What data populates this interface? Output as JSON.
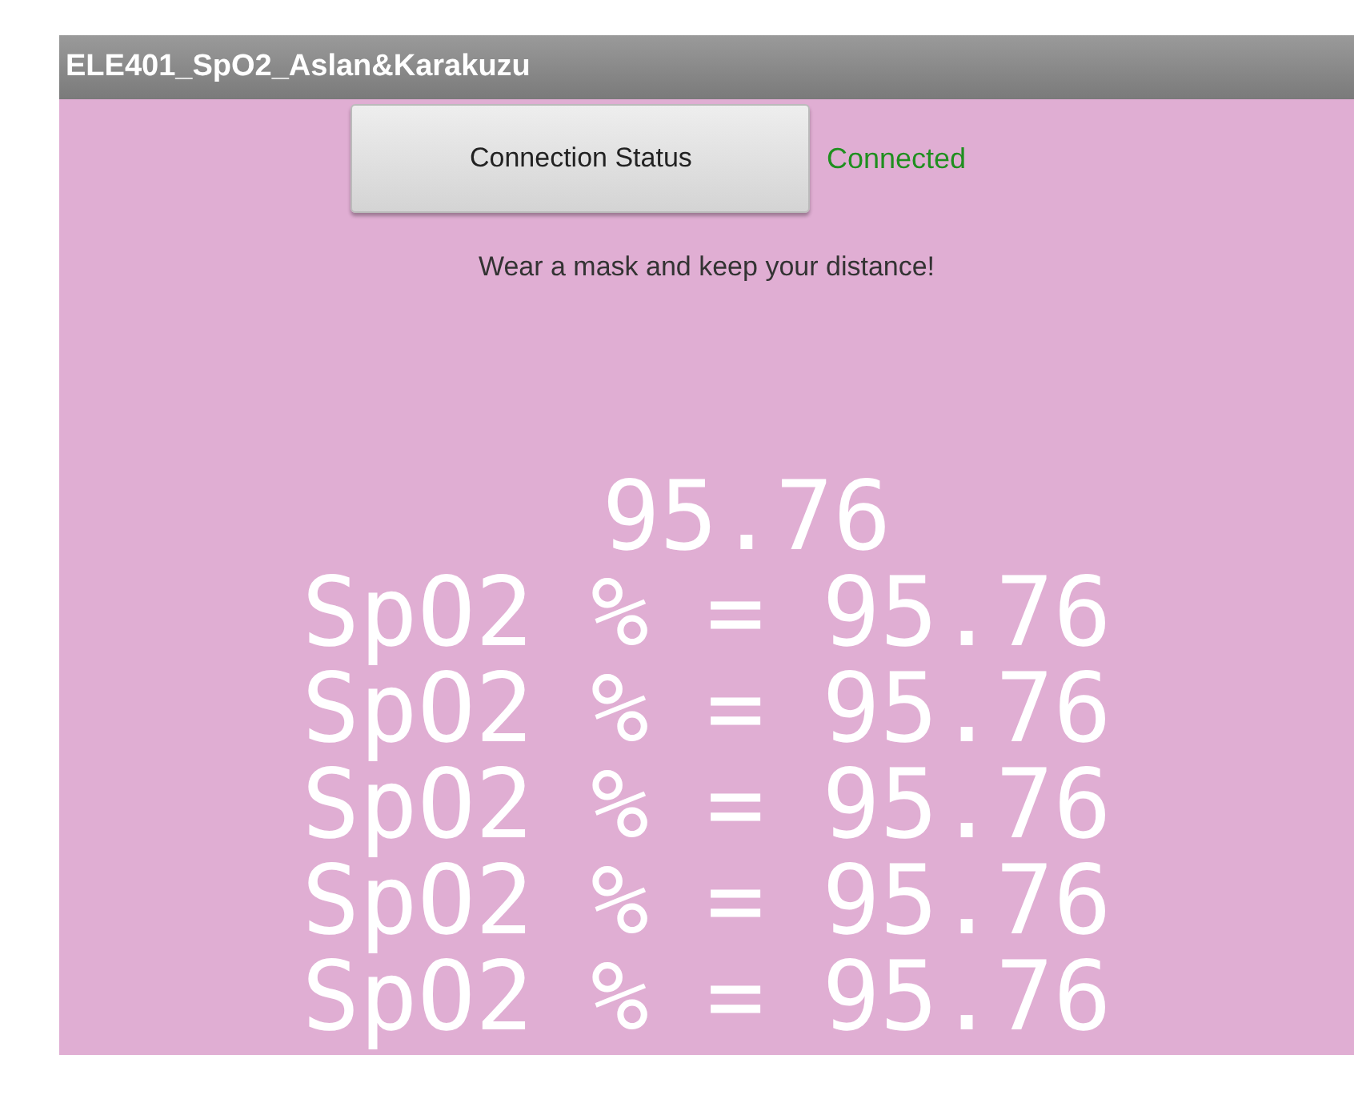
{
  "window": {
    "title": "ELE401_SpO2_Aslan&Karakuzu"
  },
  "connection": {
    "button": "Connection Status",
    "status": "Connected",
    "connected": true
  },
  "message": "Wear a mask and keep your distance!",
  "readings": [
    "95.76",
    "SpO2 % = 95.76",
    "SpO2 % = 95.76",
    "SpO2 % = 95.76",
    "SpO2 % = 95.76",
    "SpO2 % = 95.76"
  ]
}
